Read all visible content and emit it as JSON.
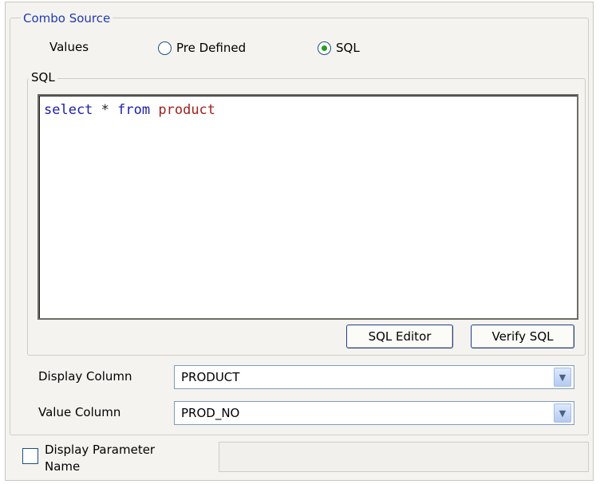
{
  "combo_source": {
    "title": "Combo Source",
    "values_label": "Values",
    "options": [
      {
        "label": "Pre Defined",
        "selected": false
      },
      {
        "label": "SQL",
        "selected": true
      }
    ]
  },
  "sql": {
    "group_label": "SQL",
    "query_tokens": {
      "select": "select",
      "star": "*",
      "from": "from",
      "table": "product"
    },
    "editor_button": "SQL Editor",
    "verify_button": "Verify SQL"
  },
  "display_column": {
    "label": "Display Column",
    "value": "PRODUCT"
  },
  "value_column": {
    "label": "Value Column",
    "value": "PROD_NO"
  },
  "display_parameter": {
    "label_line1": "Display Parameter",
    "label_line2": "Name",
    "checked": false,
    "value": ""
  },
  "colors": {
    "keyword": "#1b1fa8",
    "identifier": "#a0221c",
    "title_blue": "#1f3bb3",
    "radio_selected": "#21a121"
  }
}
